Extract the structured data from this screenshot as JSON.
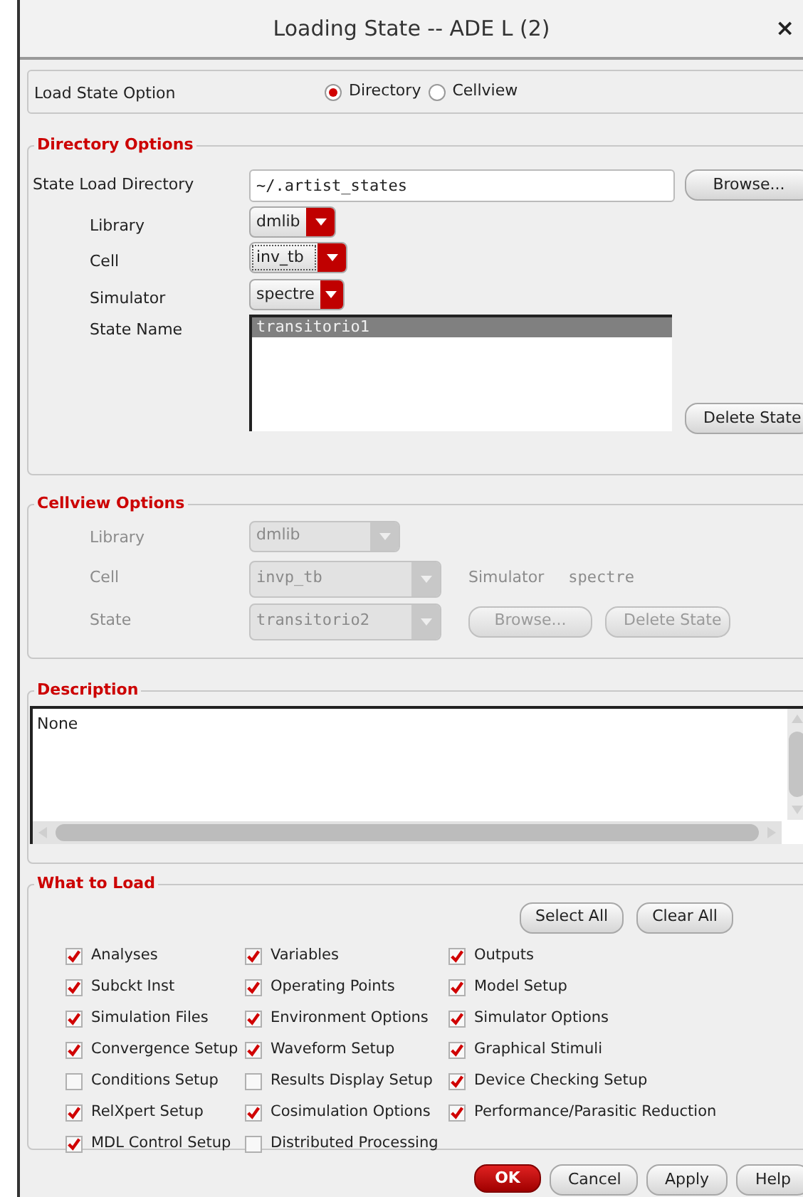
{
  "window": {
    "title": "Loading State -- ADE L (2)",
    "close": "×"
  },
  "load_state_option": {
    "label": "Load State Option",
    "options": [
      {
        "label": "Directory",
        "selected": true
      },
      {
        "label": "Cellview",
        "selected": false
      }
    ]
  },
  "directory_options": {
    "title": "Directory Options",
    "state_load_directory": {
      "label": "State Load Directory",
      "value": "~/.artist_states"
    },
    "browse_button": "Browse...",
    "fields": [
      {
        "label": "Library",
        "value": "dmlib",
        "focused": false
      },
      {
        "label": "Cell",
        "value": "inv_tb",
        "focused": true
      },
      {
        "label": "Simulator",
        "value": "spectre",
        "focused": false
      }
    ],
    "state_name": {
      "label": "State Name",
      "items": [
        {
          "text": "transitorio1",
          "selected": true
        }
      ]
    },
    "delete_button": "Delete State"
  },
  "cellview_options": {
    "title": "Cellview Options",
    "disabled": true,
    "library": {
      "label": "Library",
      "value": "dmlib"
    },
    "cell": {
      "label": "Cell",
      "value": "invp_tb"
    },
    "simulator_label": "Simulator",
    "simulator_value": "spectre",
    "state": {
      "label": "State",
      "value": "transitorio2"
    },
    "browse_button": "Browse...",
    "delete_button": "Delete State"
  },
  "description": {
    "title": "Description",
    "value": "None"
  },
  "what_to_load": {
    "title": "What to Load",
    "buttons": [
      "Select All",
      "Clear All"
    ],
    "items": [
      {
        "label": "Analyses",
        "checked": true
      },
      {
        "label": "Variables",
        "checked": true
      },
      {
        "label": "Outputs",
        "checked": true
      },
      {
        "label": "Subckt Inst",
        "checked": true
      },
      {
        "label": "Operating Points",
        "checked": true
      },
      {
        "label": "Model Setup",
        "checked": true
      },
      {
        "label": "Simulation Files",
        "checked": true
      },
      {
        "label": "Environment Options",
        "checked": true
      },
      {
        "label": "Simulator Options",
        "checked": true
      },
      {
        "label": "Convergence Setup",
        "checked": true
      },
      {
        "label": "Waveform Setup",
        "checked": true
      },
      {
        "label": "Graphical Stimuli",
        "checked": true
      },
      {
        "label": "Conditions Setup",
        "checked": false
      },
      {
        "label": "Results Display Setup",
        "checked": false
      },
      {
        "label": "Device Checking Setup",
        "checked": true
      },
      {
        "label": "RelXpert Setup",
        "checked": true
      },
      {
        "label": "Cosimulation Options",
        "checked": true
      },
      {
        "label": "Performance/Parasitic Reduction",
        "checked": true
      },
      {
        "label": "MDL Control Setup",
        "checked": true
      },
      {
        "label": "Distributed Processing",
        "checked": false
      }
    ]
  },
  "buttons": [
    {
      "label": "OK",
      "kind": "default"
    },
    {
      "label": "Cancel",
      "kind": "normal"
    },
    {
      "label": "Apply",
      "kind": "normal"
    },
    {
      "label": "Help",
      "kind": "normal"
    }
  ]
}
